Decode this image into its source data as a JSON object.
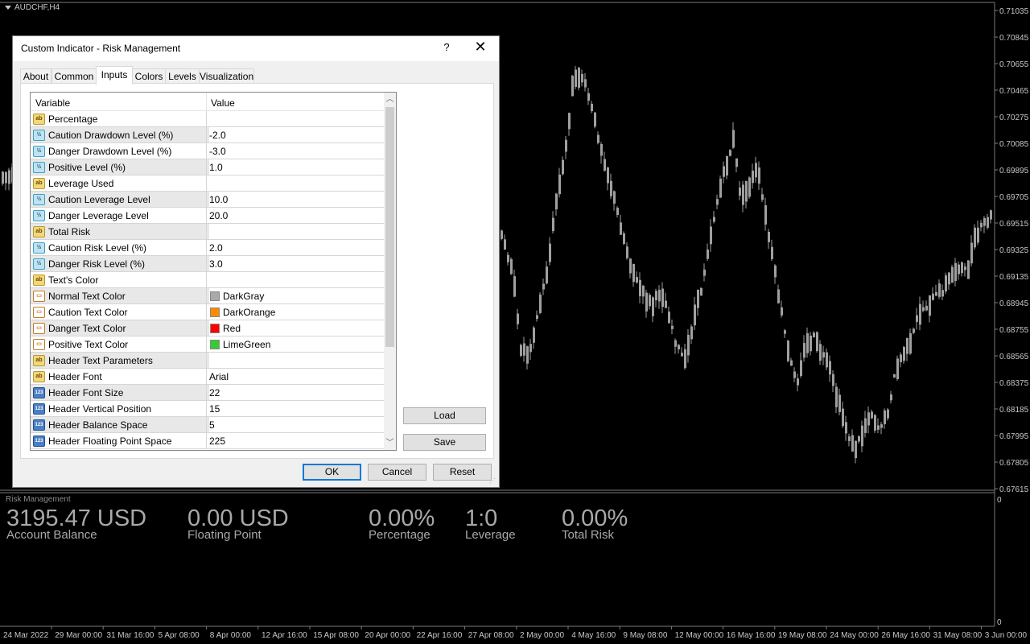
{
  "chart": {
    "symbol": "AUDCHF,H4",
    "price_ticks": [
      "0.71035",
      "0.70845",
      "0.70655",
      "0.70465",
      "0.70275",
      "0.70085",
      "0.69895",
      "0.69705",
      "0.69515",
      "0.69325",
      "0.69135",
      "0.68945",
      "0.68755",
      "0.68565",
      "0.68375",
      "0.68185",
      "0.67995",
      "0.67805",
      "0.67615"
    ],
    "indicator_scale": [
      "0",
      "0"
    ],
    "time_ticks": [
      "24 Mar 2022",
      "29 Mar 00:00",
      "31 Mar 16:00",
      "5 Apr 08:00",
      "8 Apr 00:00",
      "12 Apr 16:00",
      "15 Apr 08:00",
      "20 Apr 00:00",
      "22 Apr 16:00",
      "27 Apr 08:00",
      "2 May 00:00",
      "4 May 16:00",
      "9 May 08:00",
      "12 May 00:00",
      "16 May 16:00",
      "19 May 08:00",
      "24 May 00:00",
      "26 May 16:00",
      "31 May 08:00",
      "3 Jun 00:00"
    ],
    "colors": {
      "background": "#000000",
      "candle": "#a0a0a0",
      "grid_line": "#7a7a7a",
      "axis_text": "#c8c8c8"
    }
  },
  "indicator": {
    "title": "Risk Management",
    "metrics": [
      {
        "value": "3195.47 USD",
        "label": "Account Balance"
      },
      {
        "value": "0.00 USD",
        "label": "Floating Point"
      },
      {
        "value": "0.00%",
        "label": "Percentage"
      },
      {
        "value": "1:0",
        "label": "Leverage"
      },
      {
        "value": "0.00%",
        "label": "Total Risk"
      }
    ]
  },
  "dialog": {
    "title": "Custom Indicator - Risk Management",
    "help": "?",
    "close": "✕",
    "tabs": [
      "About",
      "Common",
      "Inputs",
      "Colors",
      "Levels",
      "Visualization"
    ],
    "active_tab": "Inputs",
    "grid": {
      "col_variable": "Variable",
      "col_value": "Value",
      "rows": [
        {
          "icon": "ab",
          "icon_name": "string-type-icon",
          "name": "Percentage",
          "value": ""
        },
        {
          "icon": "dbl",
          "icon_name": "double-type-icon",
          "name": "Caution Drawdown Level (%)",
          "value": "-2.0"
        },
        {
          "icon": "dbl",
          "icon_name": "double-type-icon",
          "name": "Danger Drawdown Level (%)",
          "value": "-3.0"
        },
        {
          "icon": "dbl",
          "icon_name": "double-type-icon",
          "name": "Positive Level (%)",
          "value": "1.0"
        },
        {
          "icon": "ab",
          "icon_name": "string-type-icon",
          "name": "Leverage Used",
          "value": ""
        },
        {
          "icon": "dbl",
          "icon_name": "double-type-icon",
          "name": "Caution Leverage Level",
          "value": "10.0"
        },
        {
          "icon": "dbl",
          "icon_name": "double-type-icon",
          "name": "Danger Leverage Level",
          "value": "20.0"
        },
        {
          "icon": "ab",
          "icon_name": "string-type-icon",
          "name": "Total Risk",
          "value": ""
        },
        {
          "icon": "dbl",
          "icon_name": "double-type-icon",
          "name": "Caution Risk Level (%)",
          "value": "2.0"
        },
        {
          "icon": "dbl",
          "icon_name": "double-type-icon",
          "name": "Danger Risk Level (%)",
          "value": "3.0"
        },
        {
          "icon": "ab",
          "icon_name": "string-type-icon",
          "name": "Text's Color",
          "value": ""
        },
        {
          "icon": "col",
          "icon_name": "color-type-icon",
          "name": "Normal Text Color",
          "value": "DarkGray",
          "swatch": "#a9a9a9"
        },
        {
          "icon": "col",
          "icon_name": "color-type-icon",
          "name": "Caution Text Color",
          "value": "DarkOrange",
          "swatch": "#ff8c00"
        },
        {
          "icon": "col",
          "icon_name": "color-type-icon",
          "name": "Danger Text Color",
          "value": "Red",
          "swatch": "#ff0000"
        },
        {
          "icon": "col",
          "icon_name": "color-type-icon",
          "name": "Positive Text Color",
          "value": "LimeGreen",
          "swatch": "#32cd32"
        },
        {
          "icon": "ab",
          "icon_name": "string-type-icon",
          "name": "Header Text Parameters",
          "value": ""
        },
        {
          "icon": "ab",
          "icon_name": "string-type-icon",
          "name": "Header Font",
          "value": "Arial"
        },
        {
          "icon": "num",
          "icon_name": "integer-type-icon",
          "name": "Header Font Size",
          "value": "22"
        },
        {
          "icon": "num",
          "icon_name": "integer-type-icon",
          "name": "Header Vertical Position",
          "value": "15"
        },
        {
          "icon": "num",
          "icon_name": "integer-type-icon",
          "name": "Header Balance Space",
          "value": "5"
        },
        {
          "icon": "num",
          "icon_name": "integer-type-icon",
          "name": "Header Floating Point Space",
          "value": "225"
        }
      ]
    },
    "buttons": {
      "load": "Load",
      "save": "Save",
      "ok": "OK",
      "cancel": "Cancel",
      "reset": "Reset"
    }
  }
}
